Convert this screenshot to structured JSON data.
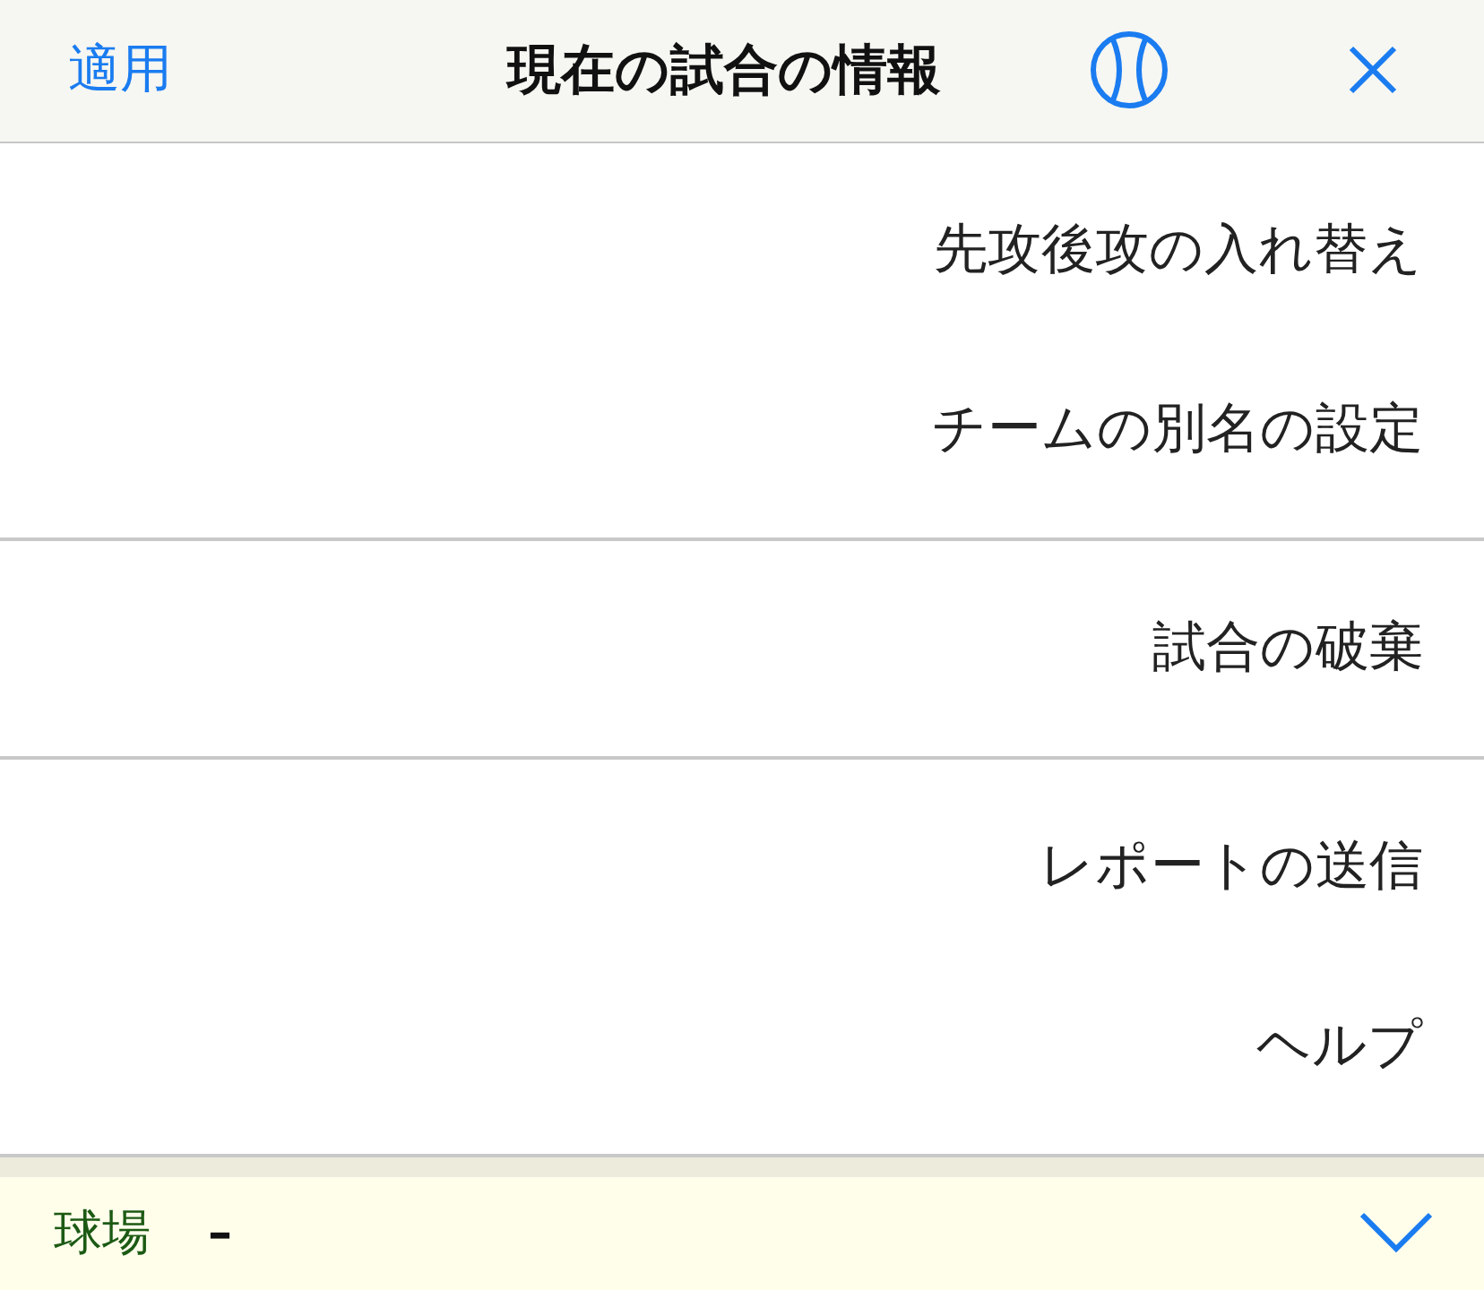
{
  "header": {
    "apply": "適用",
    "title": "現在の試合の情報"
  },
  "menu_groups": [
    {
      "items": [
        "先攻後攻の入れ替え",
        "チームの別名の設定"
      ]
    },
    {
      "items": [
        "試合の破棄"
      ]
    },
    {
      "items": [
        "レポートの送信",
        "ヘルプ"
      ]
    }
  ],
  "footer": {
    "label": "球場",
    "value": "–",
    "expanded": false
  }
}
